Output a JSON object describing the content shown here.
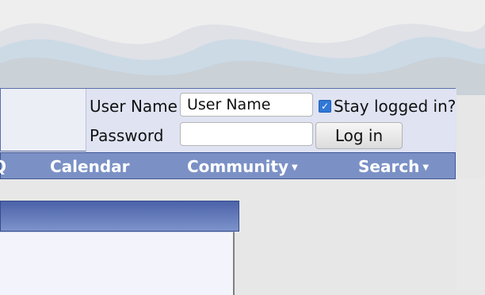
{
  "login": {
    "username_label": "User Name",
    "username_value": "User Name",
    "stay_logged_in_label": "Stay logged in?",
    "stay_logged_in_checked": true,
    "password_label": "Password",
    "password_value": "",
    "login_button": "Log in"
  },
  "nav": {
    "items": [
      {
        "label": "Q",
        "has_menu": false
      },
      {
        "label": "Calendar",
        "has_menu": false
      },
      {
        "label": "Community",
        "has_menu": true
      },
      {
        "label": "Search",
        "has_menu": true
      }
    ]
  },
  "colors": {
    "navbar": "#7b91c6",
    "header_gradient_top": "#4b62a9",
    "checkbox": "#2f78d6"
  },
  "icons": [
    "checkbox-checked-icon",
    "caret-down-icon"
  ]
}
